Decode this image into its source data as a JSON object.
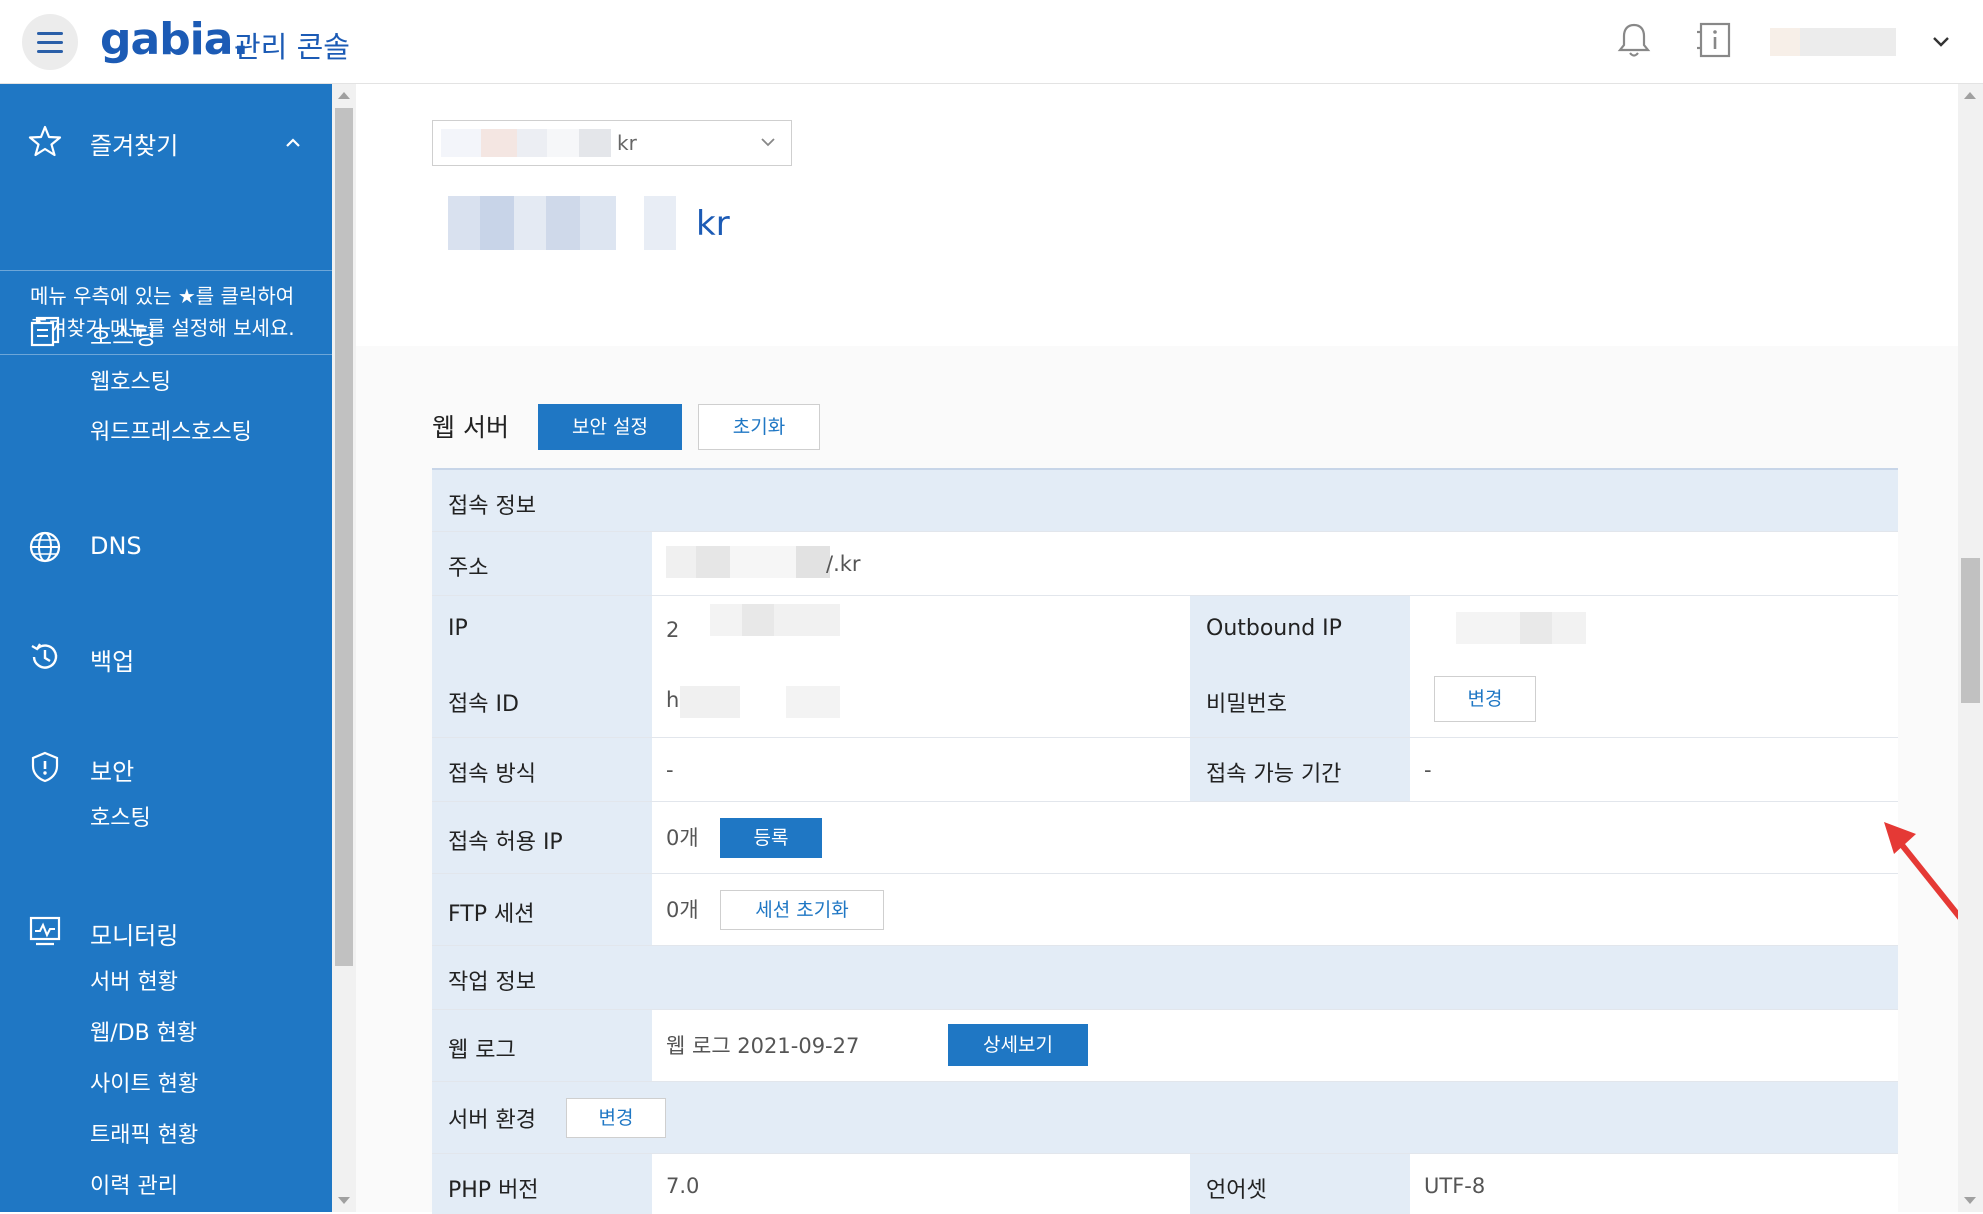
{
  "header": {
    "logo_text": "gabia.",
    "console_title": "관리 콘솔"
  },
  "sidebar": {
    "favorites": {
      "title": "즐겨찾기",
      "note_line1": "메뉴 우측에 있는 ★를 클릭하여",
      "note_line2": "즐겨찾기 메뉴를 설정해 보세요."
    },
    "hosting": {
      "title": "호스팅",
      "items": [
        "웹호스팅",
        "워드프레스호스팅"
      ]
    },
    "dns": {
      "title": "DNS"
    },
    "backup": {
      "title": "백업"
    },
    "security": {
      "title": "보안",
      "items": [
        "호스팅"
      ]
    },
    "monitoring": {
      "title": "모니터링",
      "items": [
        "서버 현황",
        "웹/DB 현황",
        "사이트 현황",
        "트래픽 현황",
        "이력 관리"
      ]
    }
  },
  "top": {
    "domain_select_suffix": "kr",
    "domain_title_suffix": "kr"
  },
  "webserver": {
    "section_title": "웹 서버",
    "security_button": "보안 설정",
    "reset_button": "초기화"
  },
  "table": {
    "access_info_title": "접속 정보",
    "address_label": "주소",
    "address_value_suffix": "/.kr",
    "ip_label": "IP",
    "ip_value_prefix": "2",
    "outbound_ip_label": "Outbound IP",
    "access_id_label": "접속 ID",
    "access_id_prefix": "h",
    "password_label": "비밀번호",
    "password_change_button": "변경",
    "access_method_label": "접속 방식",
    "access_method_value": "-",
    "access_period_label": "접속 가능 기간",
    "access_period_value": "-",
    "allowed_ip_label": "접속 허용 IP",
    "allowed_ip_count": "0개",
    "register_button": "등록",
    "ftp_session_label": "FTP 세션",
    "ftp_session_count": "0개",
    "session_reset_button": "세션 초기화",
    "work_info_title": "작업 정보",
    "web_log_label": "웹 로그",
    "web_log_value": "웹 로그 2021-09-27",
    "detail_button": "상세보기",
    "server_env_title": "서버 환경",
    "server_env_change_button": "변경",
    "php_label": "PHP 버전",
    "php_value": "7.0",
    "charset_label": "언어셋",
    "charset_value": "UTF-8"
  },
  "colors": {
    "primary": "#1f77c4",
    "header_row": "#e3ecf6",
    "annotation_arrow": "#e53935"
  }
}
